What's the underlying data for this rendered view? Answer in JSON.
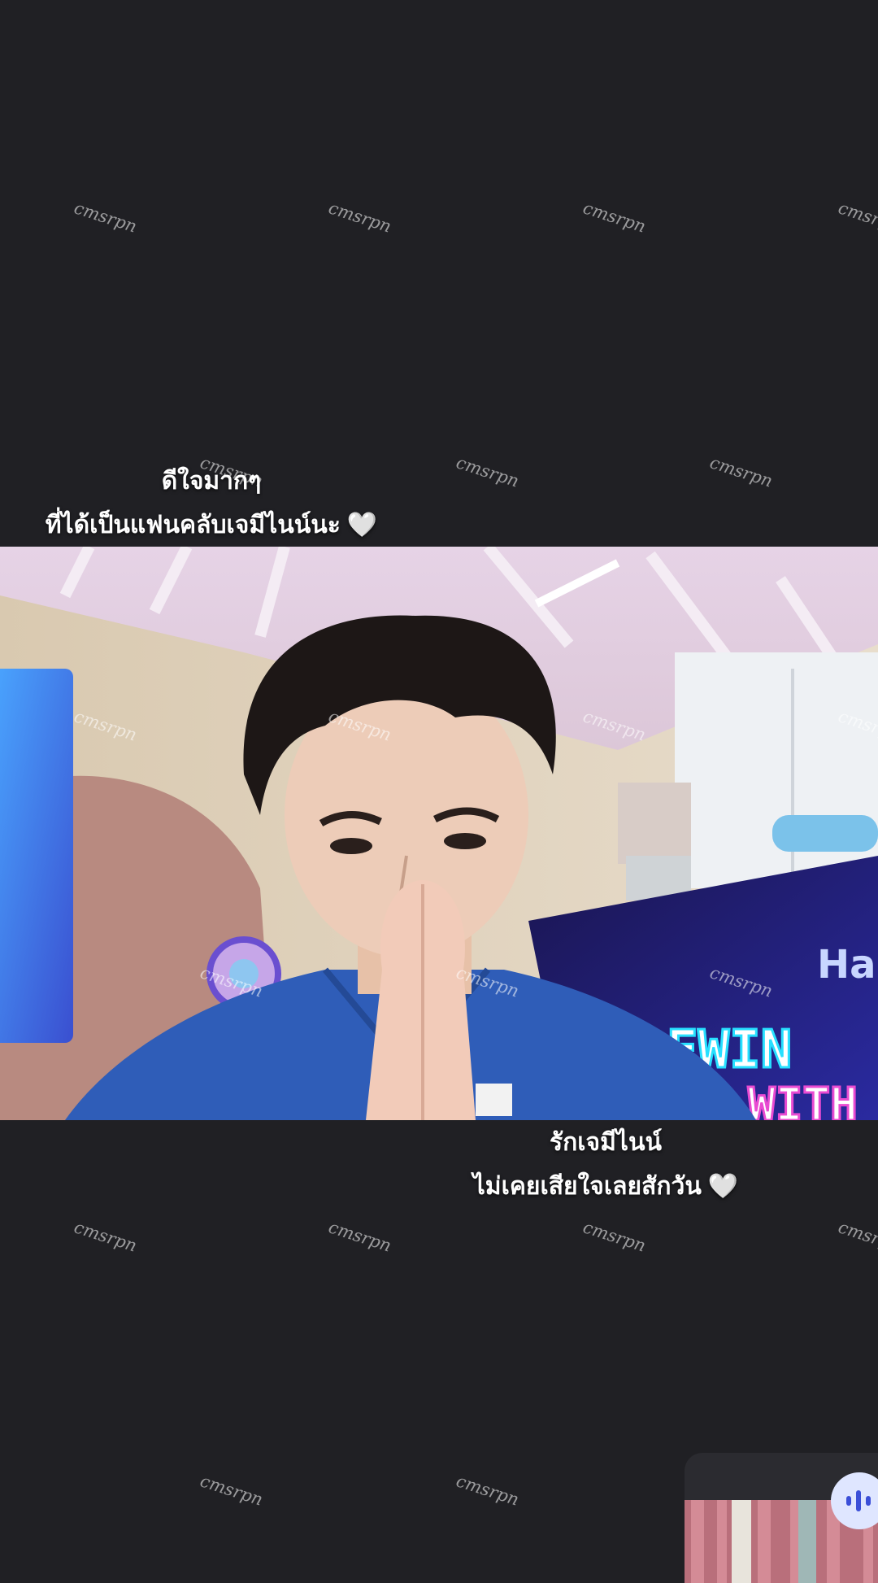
{
  "caption_top": {
    "line1": "ดีใจมากๆ",
    "line2": "ที่ได้เป็นแฟนคลับเจมีไนน์นะ",
    "heart": "🤍"
  },
  "caption_bottom": {
    "line1": "รักเจมีไนน์",
    "line2": "ไม่เคยเสียใจเลยสักวัน",
    "heart": "🤍"
  },
  "video": {
    "screen_text_line1": "Hai",
    "screen_text_line2": "EWIN",
    "screen_text_line3": "WITH"
  },
  "watermark": {
    "text": "cmsrpn"
  },
  "icons": {
    "audio": "audio-waveform-icon",
    "heart": "white-heart-icon"
  },
  "colors": {
    "background": "#202024",
    "audio_button": "#dfe6ff",
    "scrubs": "#2f5db8"
  }
}
